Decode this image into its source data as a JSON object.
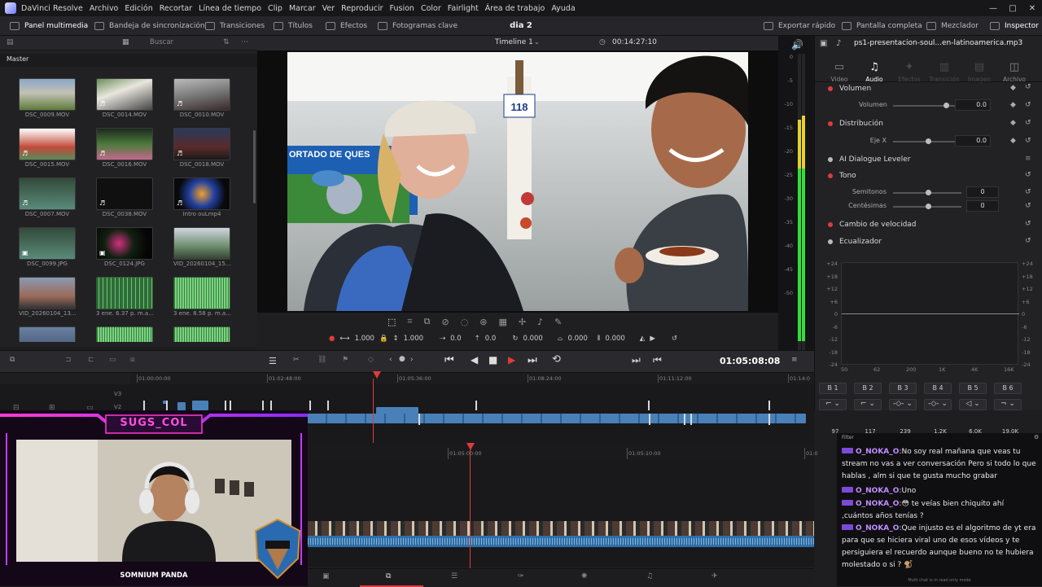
{
  "app": {
    "title": "DaVinci Resolve",
    "project": "dia 2"
  },
  "menu": [
    "Archivo",
    "Edición",
    "Recortar",
    "Línea de tiempo",
    "Clip",
    "Marcar",
    "Ver",
    "Reproducir",
    "Fusion",
    "Color",
    "Fairlight",
    "Área de trabajo",
    "Ayuda"
  ],
  "window_controls": [
    "—",
    "□",
    "✕"
  ],
  "toolbar": {
    "left": [
      "Panel multimedia",
      "Bandeja de sincronización",
      "Transiciones",
      "Títulos",
      "Efectos",
      "Fotogramas clave"
    ],
    "right": [
      "Exportar rápido",
      "Pantalla completa",
      "Mezclador",
      "Inspector"
    ]
  },
  "media_pool": {
    "search_placeholder": "Buscar",
    "bin": "Master",
    "clips": [
      {
        "name": "DSC_0009.MOV",
        "thumb": "v1",
        "badge": ""
      },
      {
        "name": "DSC_0014.MOV",
        "thumb": "v2",
        "badge": "♬"
      },
      {
        "name": "DSC_0010.MOV",
        "thumb": "v3",
        "badge": "♬"
      },
      {
        "name": "DSC_0015.MOV",
        "thumb": "v4",
        "badge": "♬"
      },
      {
        "name": "DSC_0016.MOV",
        "thumb": "v5",
        "badge": "♬"
      },
      {
        "name": "DSC_0018.MOV",
        "thumb": "v6",
        "badge": "♬"
      },
      {
        "name": "DSC_0007.MOV",
        "thumb": "v9",
        "badge": "♬"
      },
      {
        "name": "DSC_0038.MOV",
        "thumb": "v7",
        "badge": "♬"
      },
      {
        "name": "Intro ouLmp4",
        "thumb": "v8",
        "badge": "♬"
      },
      {
        "name": "DSC_0099.JPG",
        "thumb": "v9",
        "badge": "▣"
      },
      {
        "name": "DSC_0124.JPG",
        "thumb": "v10",
        "badge": "▣"
      },
      {
        "name": "VID_20260104_15...",
        "thumb": "v11",
        "badge": ""
      },
      {
        "name": "VID_20260104_13...",
        "thumb": "v12",
        "badge": ""
      },
      {
        "name": "3 ene. 6.37 p. m.a...",
        "thumb": "aud",
        "badge": ""
      },
      {
        "name": "3 ene. 8.58 p. m.a...",
        "thumb": "aud2",
        "badge": ""
      },
      {
        "name": "",
        "thumb": "v13",
        "badge": ""
      },
      {
        "name": "",
        "thumb": "aud2",
        "badge": ""
      },
      {
        "name": "",
        "thumb": "aud2",
        "badge": ""
      }
    ]
  },
  "viewer": {
    "timeline_name": "Timeline 1",
    "timecode": "00:14:27:10",
    "sign_number": "118",
    "sign_text": "ORTADO DE QUES",
    "transform": {
      "zoom_x": "1.000",
      "zoom_y": "1.000",
      "pos_x": "0.0",
      "pos_y": "0.0",
      "rotation": "0.000",
      "pitch": "0.000",
      "yaw": "0.000"
    }
  },
  "meters": {
    "scale": [
      "0",
      "-5",
      "-10",
      "-15",
      "-20",
      "-25",
      "-30",
      "-35",
      "-40",
      "-45",
      "-50"
    ]
  },
  "inspector": {
    "filename": "ps1-presentacion-soul...en-latinoamerica.mp3",
    "tabs": [
      {
        "label": "Video",
        "icon": "▭",
        "state": ""
      },
      {
        "label": "Audio",
        "icon": "♫",
        "state": "on"
      },
      {
        "label": "Efectos",
        "icon": "✦",
        "state": "dim"
      },
      {
        "label": "Transición",
        "icon": "▥",
        "state": "dim"
      },
      {
        "label": "Imagen",
        "icon": "▤",
        "state": "dim"
      },
      {
        "label": "Archivo",
        "icon": "◫",
        "state": ""
      }
    ],
    "volume": {
      "title": "Volumen",
      "label": "Volumen",
      "value": "0.0",
      "level": 0.0
    },
    "distribution": {
      "title": "Distribución",
      "label": "Eje X",
      "value": "0.0",
      "level": 0.0
    },
    "dialogue": "AI Dialogue Leveler",
    "pitch": {
      "title": "Tono",
      "semitones_label": "Semitonos",
      "semitones": "0",
      "cents_label": "Centésimas",
      "cents": "0"
    },
    "speed": "Cambio de velocidad",
    "eq": {
      "title": "Ecualizador",
      "db_scale": [
        "+24",
        "+18",
        "+12",
        "+6",
        "0",
        "-6",
        "-12",
        "-18",
        "-24"
      ],
      "freq_scale": [
        "50",
        "62",
        "200",
        "1K",
        "4K",
        "16K"
      ],
      "bands": [
        "B 1",
        "B 2",
        "B 3",
        "B 4",
        "B 5",
        "B 6"
      ],
      "band_values": [
        "97",
        "117",
        "239",
        "1.2K",
        "6.0K",
        "19.0K"
      ]
    }
  },
  "transport": {
    "timecode": "01:05:08:08"
  },
  "timeline": {
    "ruler_top": [
      "01:00:00:00",
      "01:02:48:00",
      "01:05:36:00",
      "01:08:24:00",
      "01:11:12:00",
      "01:14:0"
    ],
    "ruler_bottom": [
      "01:05:00:00",
      "01:05:10:00",
      "01:0"
    ],
    "tracks": [
      "V3",
      "V2"
    ]
  },
  "stream": {
    "streamer_name": "SUGS_COL",
    "subtitle": "SOMNIUM PANDA"
  },
  "chat": {
    "filter": "Filter",
    "footer": "Multi chat is in read only mode",
    "messages": [
      {
        "user": "O_NOKA_O",
        "text": "No soy real mañana que veas tu stream no vas a ver conversación Pero si todo lo que hablas , alm si que te gusta mucho grabar"
      },
      {
        "user": "O_NOKA_O",
        "text": "Uno"
      },
      {
        "user": "O_NOKA_O",
        "text": "😳 te veías bien chiquito ahí ,cuántos años tenías ?"
      },
      {
        "user": "O_NOKA_O",
        "text": "Que injusto es el algoritmo de yt era para que se hiciera viral uno de esos vídeos y te persiguiera el recuerdo aunque bueno no te hubiera molestado o si ? 🐒"
      }
    ]
  },
  "colors": {
    "accent": "#e03b3b",
    "clip_blue": "#4a80b8",
    "audio_green": "#3fae4a",
    "meter_green": "#2fe03a"
  }
}
